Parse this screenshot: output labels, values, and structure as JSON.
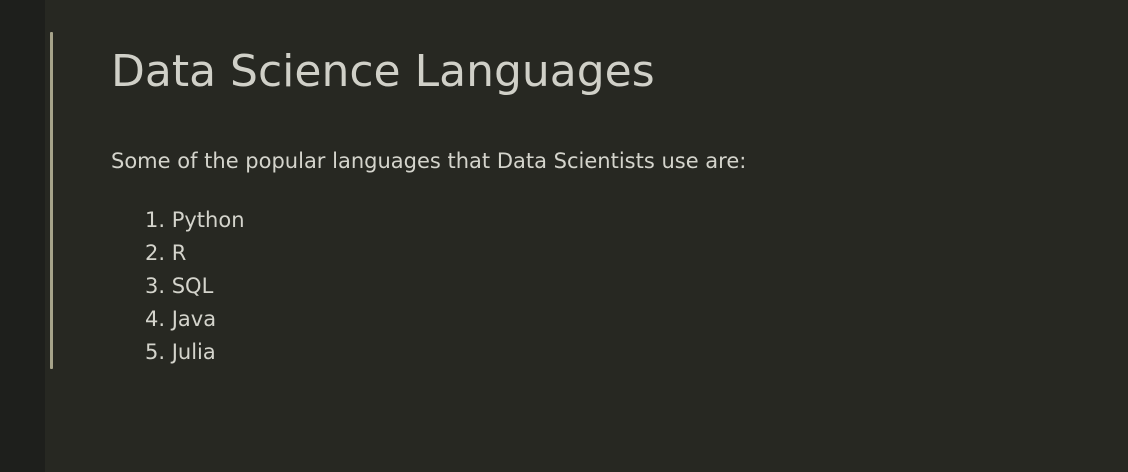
{
  "markdown_cell": {
    "title": "Data Science Languages",
    "intro": "Some of the popular languages that Data Scientists use are:",
    "languages": [
      "1. Python",
      "2. R",
      "3. SQL",
      "4. Java",
      "5. Julia"
    ]
  },
  "colors": {
    "background": "#272822",
    "gutter": "#1e1f1c",
    "focus_bar": "#a6a38a",
    "text": "#d4d4cc"
  }
}
